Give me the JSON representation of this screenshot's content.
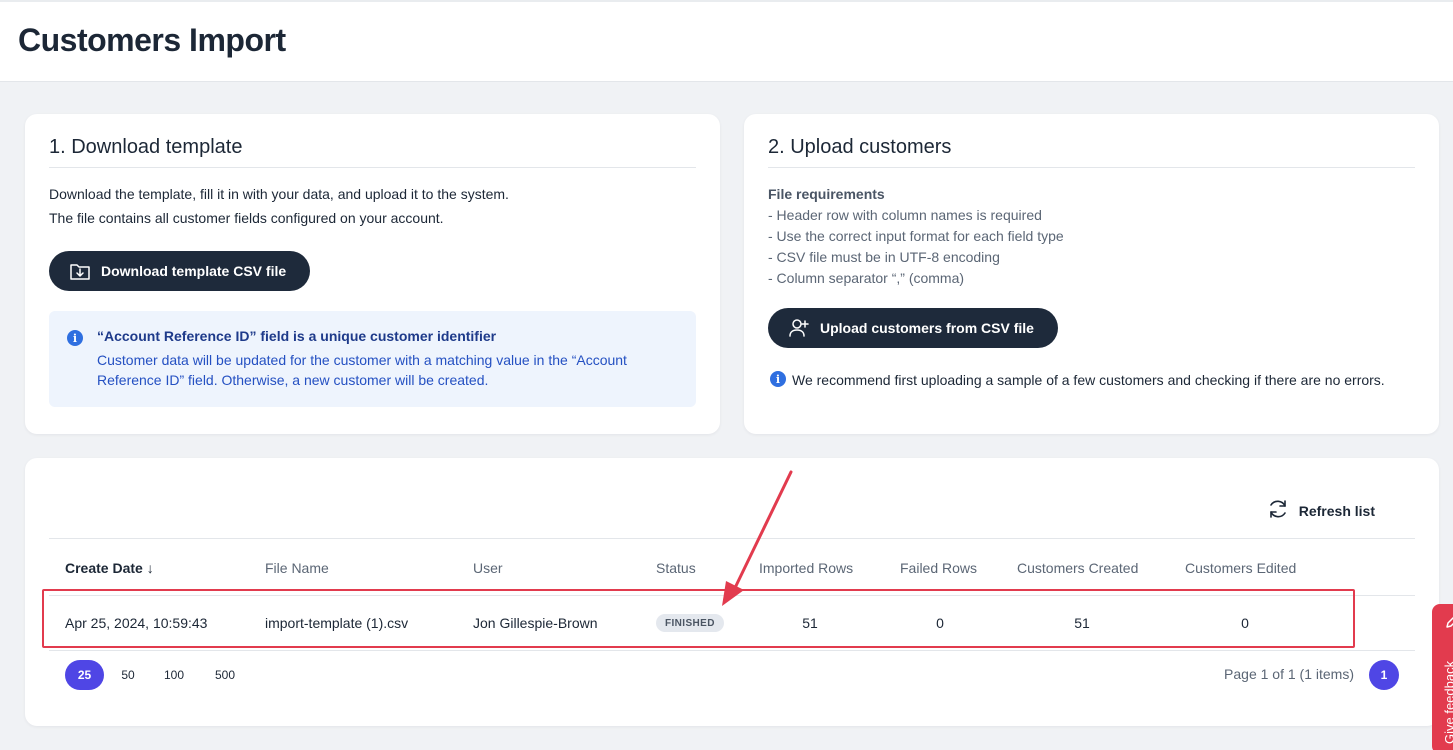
{
  "page": {
    "title": "Customers Import"
  },
  "download_card": {
    "title": "1. Download template",
    "desc_line1": "Download the template, fill it in with your data, and upload it to the system.",
    "desc_line2": "The file contains all customer fields configured on your account.",
    "button_label": "Download template CSV file",
    "info_title": "“Account Reference ID” field is a unique customer identifier",
    "info_text": "Customer data will be updated for the customer with a matching value in the “Account Reference ID” field. Otherwise, a new customer will be created."
  },
  "upload_card": {
    "title": "2. Upload customers",
    "requirements_title": "File requirements",
    "requirements": [
      "- Header row with column names is required",
      "- Use the correct input format for each field type",
      "- CSV file must be in UTF-8 encoding",
      "- Column separator “,” (comma)"
    ],
    "button_label": "Upload customers from CSV file",
    "recommendation": "We recommend first uploading a sample of a few customers and checking if there are no errors."
  },
  "imports_table": {
    "refresh_label": "Refresh list",
    "columns": [
      "Create Date ↓",
      "File Name",
      "User",
      "Status",
      "Imported Rows",
      "Failed Rows",
      "Customers Created",
      "Customers Edited"
    ],
    "rows": [
      {
        "create_date": "Apr 25, 2024, 10:59:43",
        "file_name": "import-template (1).csv",
        "user": "Jon Gillespie-Brown",
        "status": "FINISHED",
        "imported_rows": "51",
        "failed_rows": "0",
        "customers_created": "51",
        "customers_edited": "0"
      }
    ],
    "page_sizes": [
      "25",
      "50",
      "100",
      "500"
    ],
    "selected_page_size": "25",
    "page_info": "Page 1 of 1 (1 items)",
    "current_page": "1"
  },
  "feedback_tab": {
    "label": "Give feedback"
  },
  "colors": {
    "primary_dark": "#1e2a3b",
    "accent_indigo": "#4f46e5",
    "info_blue": "#2f6fe0",
    "annotation_red": "#e23b4e"
  }
}
